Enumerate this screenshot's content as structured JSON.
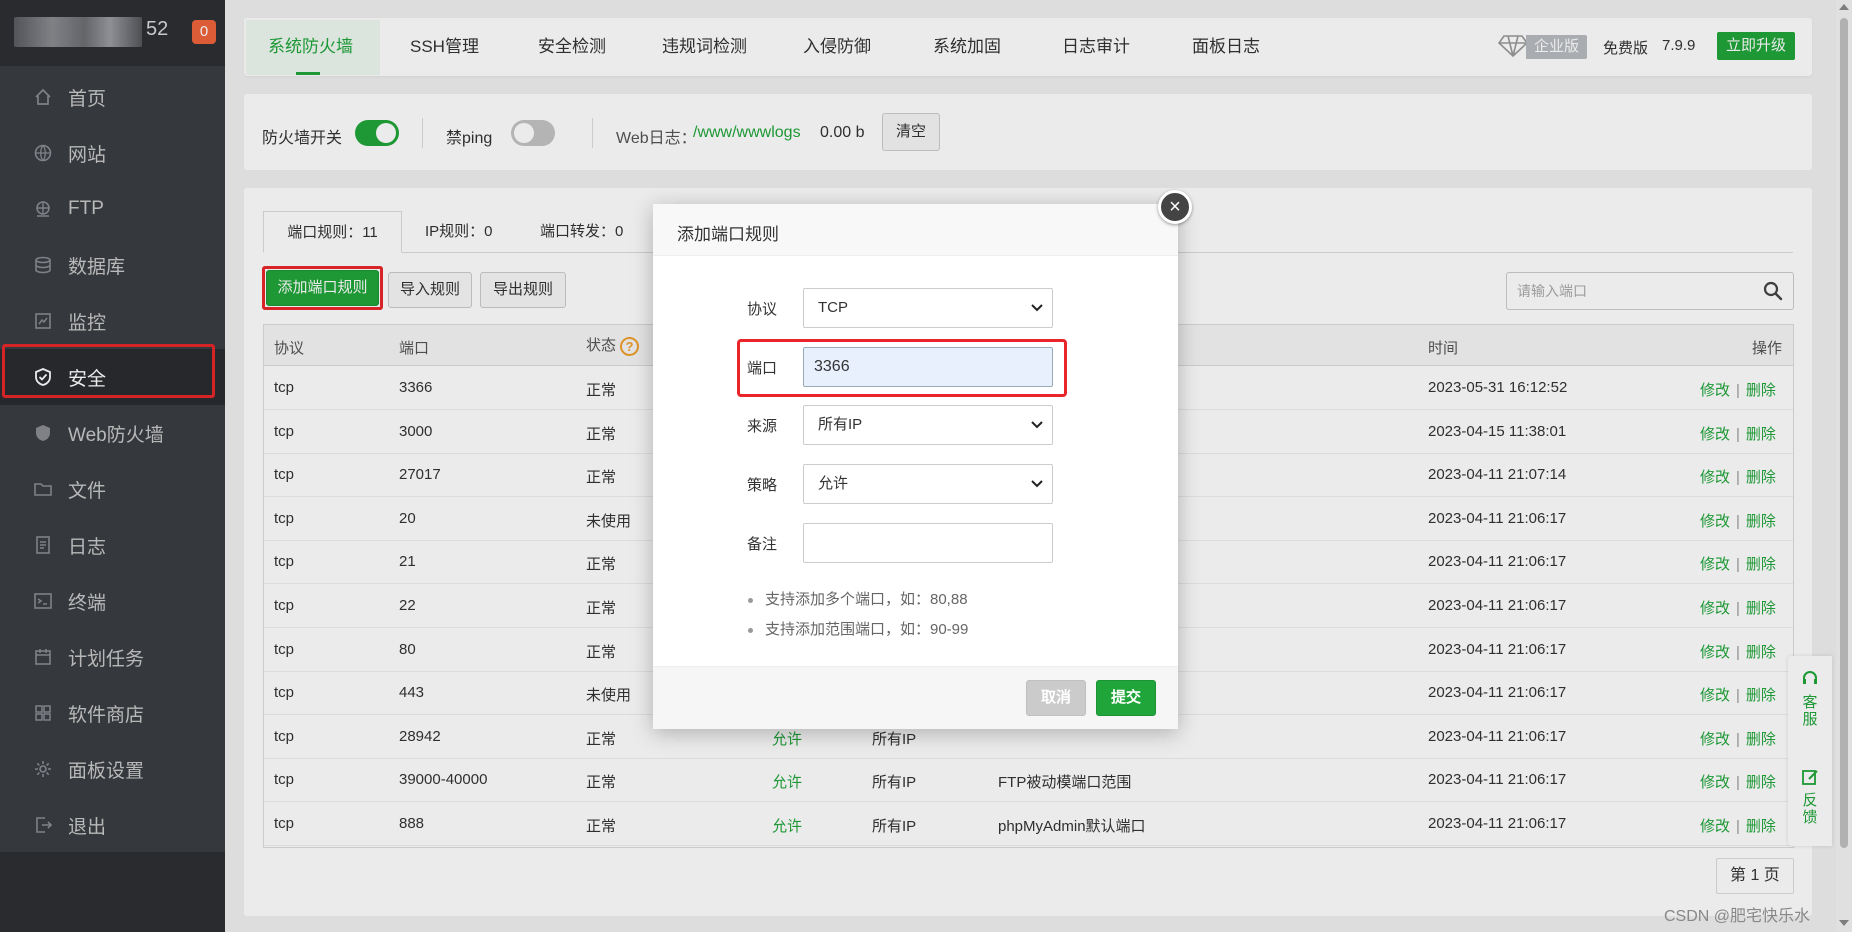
{
  "sidebar": {
    "host_suffix": "52",
    "badge": "0",
    "items": [
      {
        "label": "首页",
        "icon": "home-icon"
      },
      {
        "label": "网站",
        "icon": "globe-icon"
      },
      {
        "label": "FTP",
        "icon": "ftp-icon"
      },
      {
        "label": "数据库",
        "icon": "database-icon"
      },
      {
        "label": "监控",
        "icon": "monitor-icon"
      },
      {
        "label": "安全",
        "icon": "shield-icon",
        "active": true
      },
      {
        "label": "Web防火墙",
        "icon": "waf-shield-icon"
      },
      {
        "label": "文件",
        "icon": "folder-icon"
      },
      {
        "label": "日志",
        "icon": "log-icon"
      },
      {
        "label": "终端",
        "icon": "terminal-icon"
      },
      {
        "label": "计划任务",
        "icon": "calendar-icon"
      },
      {
        "label": "软件商店",
        "icon": "apps-icon"
      },
      {
        "label": "面板设置",
        "icon": "gear-icon"
      },
      {
        "label": "退出",
        "icon": "logout-icon"
      }
    ]
  },
  "topnav": {
    "tabs": [
      "系统防火墙",
      "SSH管理",
      "安全检测",
      "违规词检测",
      "入侵防御",
      "系统加固",
      "日志审计",
      "面板日志"
    ],
    "active_tab": "系统防火墙",
    "enterprise_label": "企业版",
    "free_label": "免费版",
    "version": "7.9.9",
    "upgrade_label": "立即升级"
  },
  "firewall_bar": {
    "switch_label": "防火墙开关",
    "switch_on": true,
    "ping_label": "禁ping",
    "ping_on": false,
    "weblog_label": "Web日志：",
    "weblog_path": "/www/wwwlogs",
    "weblog_size": "0.00 b",
    "clear_label": "清空"
  },
  "subtabs": {
    "port_rules": "端口规则：11",
    "ip_rules": "IP规则：0",
    "port_forward": "端口转发：0"
  },
  "actions": {
    "add_port_rule": "添加端口规则",
    "import_rules": "导入规则",
    "export_rules": "导出规则",
    "search_placeholder": "请输入端口"
  },
  "table": {
    "headers": {
      "protocol": "协议",
      "port": "端口",
      "status": "状态",
      "time": "时间",
      "ops": "操作"
    },
    "help_mark": "?",
    "edit_label": "修改",
    "delete_label": "删除",
    "op_sep": "|",
    "rows": [
      {
        "protocol": "tcp",
        "port": "3366",
        "status": "正常",
        "policy": "",
        "source": "",
        "note": "",
        "time": "2023-05-31 16:12:52"
      },
      {
        "protocol": "tcp",
        "port": "3000",
        "status": "正常",
        "policy": "",
        "source": "",
        "note": "",
        "time": "2023-04-15 11:38:01"
      },
      {
        "protocol": "tcp",
        "port": "27017",
        "status": "正常",
        "policy": "",
        "source": "",
        "note": "",
        "time": "2023-04-11 21:07:14"
      },
      {
        "protocol": "tcp",
        "port": "20",
        "status": "未使用",
        "policy": "",
        "source": "",
        "note": "",
        "time": "2023-04-11 21:06:17"
      },
      {
        "protocol": "tcp",
        "port": "21",
        "status": "正常",
        "policy": "",
        "source": "",
        "note": "",
        "time": "2023-04-11 21:06:17"
      },
      {
        "protocol": "tcp",
        "port": "22",
        "status": "正常",
        "policy": "",
        "source": "",
        "note": "",
        "time": "2023-04-11 21:06:17"
      },
      {
        "protocol": "tcp",
        "port": "80",
        "status": "正常",
        "policy": "",
        "source": "",
        "note": "",
        "time": "2023-04-11 21:06:17"
      },
      {
        "protocol": "tcp",
        "port": "443",
        "status": "未使用",
        "policy": "",
        "source": "",
        "note": "",
        "time": "2023-04-11 21:06:17"
      },
      {
        "protocol": "tcp",
        "port": "28942",
        "status": "正常",
        "policy": "允许",
        "source": "所有IP",
        "note": "",
        "time": "2023-04-11 21:06:17"
      },
      {
        "protocol": "tcp",
        "port": "39000-40000",
        "status": "正常",
        "policy": "允许",
        "source": "所有IP",
        "note": "FTP被动模端口范围",
        "time": "2023-04-11 21:06:17"
      },
      {
        "protocol": "tcp",
        "port": "888",
        "status": "正常",
        "policy": "允许",
        "source": "所有IP",
        "note": "phpMyAdmin默认端口",
        "time": "2023-04-11 21:06:17"
      }
    ]
  },
  "pager": {
    "label": "第 1 页"
  },
  "modal": {
    "title": "添加端口规则",
    "close_glyph": "×",
    "protocol_label": "协议",
    "protocol_value": "TCP",
    "port_label": "端口",
    "port_value": "3366",
    "source_label": "来源",
    "source_value": "所有IP",
    "policy_label": "策略",
    "policy_value": "允许",
    "note_label": "备注",
    "note_value": "",
    "tips": [
      "支持添加多个端口，如：80,88",
      "支持添加范围端口，如：90-99"
    ],
    "cancel_label": "取消",
    "submit_label": "提交"
  },
  "side_widget": {
    "service_label": "客服",
    "feedback_label": "反馈"
  },
  "watermark": "CSDN @肥宅快乐水",
  "colors": {
    "accent": "#20a53a",
    "highlight": "#e8262a",
    "sidebar": "#3a3d43"
  }
}
